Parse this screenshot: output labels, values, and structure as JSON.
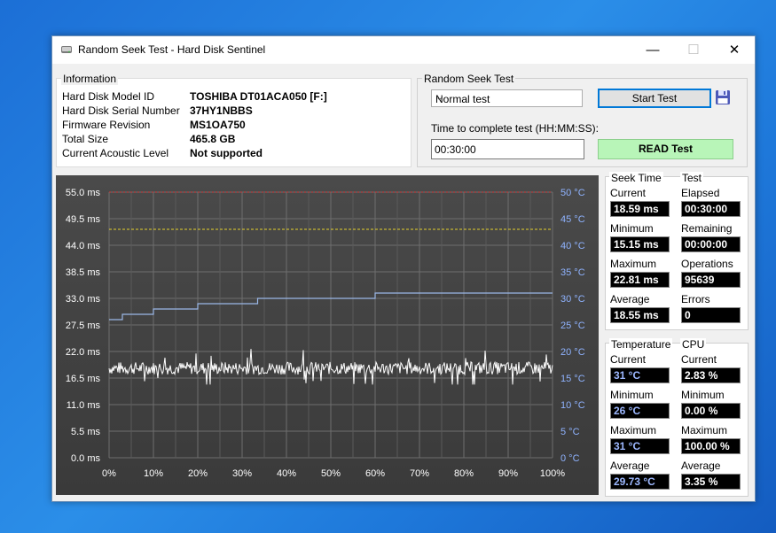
{
  "window": {
    "title": "Random Seek Test - Hard Disk Sentinel",
    "minimize": "—",
    "maximize": "☐",
    "close": "✕"
  },
  "information": {
    "title": "Information",
    "rows": [
      {
        "label": "Hard Disk Model ID",
        "value": "TOSHIBA DT01ACA050 [F:]"
      },
      {
        "label": "Hard Disk Serial Number",
        "value": "37HY1NBBS"
      },
      {
        "label": "Firmware Revision",
        "value": "MS1OA750"
      },
      {
        "label": "Total Size",
        "value": "465.8 GB"
      },
      {
        "label": "Current Acoustic Level",
        "value": "Not supported"
      }
    ]
  },
  "seek_test": {
    "title": "Random Seek Test",
    "mode": "Normal test",
    "start_button": "Start Test",
    "time_label": "Time to complete test (HH:MM:SS):",
    "time_value": "00:30:00",
    "read_button": "READ Test",
    "save_icon": "floppy-disk-icon"
  },
  "chart_data": {
    "type": "line",
    "left_axis_unit": "ms",
    "right_axis_unit": "°C",
    "y_left_ticks": [
      "55.0 ms",
      "49.5 ms",
      "44.0 ms",
      "38.5 ms",
      "33.0 ms",
      "27.5 ms",
      "22.0 ms",
      "16.5 ms",
      "11.0 ms",
      "5.5 ms",
      "0.0 ms"
    ],
    "y_right_ticks": [
      "50 °C",
      "45 °C",
      "40 °C",
      "35 °C",
      "30 °C",
      "25 °C",
      "20 °C",
      "15 °C",
      "10 °C",
      "5 °C",
      "0 °C"
    ],
    "x_ticks": [
      "0%",
      "10%",
      "20%",
      "30%",
      "40%",
      "50%",
      "60%",
      "70%",
      "80%",
      "90%",
      "100%"
    ],
    "ylim_ms": [
      0,
      55
    ],
    "ylim_c": [
      0,
      50
    ],
    "grid": true,
    "threshold_red_c": 50,
    "threshold_yellow_c": 43,
    "temperature_series": {
      "x": [
        0,
        3,
        3,
        10,
        10,
        20,
        20,
        33.5,
        33.5,
        60,
        60,
        100
      ],
      "y": [
        26,
        26,
        27,
        27,
        28,
        28,
        29,
        29,
        30,
        30,
        31,
        31
      ]
    },
    "seek_series": {
      "mean": 18.55,
      "min": 15.15,
      "max": 22.81
    },
    "colors": {
      "temperature": "#9bb8e8",
      "seek": "#ffffff",
      "red_line": "#d23b3b",
      "yellow_line": "#e6d22e",
      "axis_right": "#8fb3ff"
    }
  },
  "seek_stats": {
    "title": "Seek Time",
    "current_label": "Current",
    "current": "18.59 ms",
    "minimum_label": "Minimum",
    "minimum": "15.15 ms",
    "maximum_label": "Maximum",
    "maximum": "22.81 ms",
    "average_label": "Average",
    "average": "18.55 ms"
  },
  "test_stats": {
    "title": "Test",
    "elapsed_label": "Elapsed",
    "elapsed": "00:30:00",
    "remaining_label": "Remaining",
    "remaining": "00:00:00",
    "operations_label": "Operations",
    "operations": "95639",
    "errors_label": "Errors",
    "errors": "0"
  },
  "temp_stats": {
    "title": "Temperature",
    "current_label": "Current",
    "current": "31 °C",
    "minimum_label": "Minimum",
    "minimum": "26 °C",
    "maximum_label": "Maximum",
    "maximum": "31 °C",
    "average_label": "Average",
    "average": "29.73 °C"
  },
  "cpu_stats": {
    "title": "CPU",
    "current_label": "Current",
    "current": "2.83 %",
    "minimum_label": "Minimum",
    "minimum": "0.00 %",
    "maximum_label": "Maximum",
    "maximum": "100.00 %",
    "average_label": "Average",
    "average": "3.35 %"
  }
}
